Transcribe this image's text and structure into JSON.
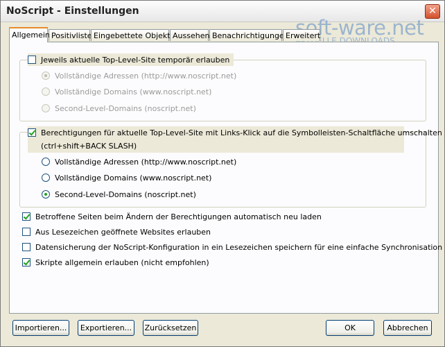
{
  "window": {
    "title": "NoScript - Einstellungen",
    "close_label": "✕"
  },
  "watermark": {
    "main": "soft-ware.net",
    "sub": "AKTUELLE DOWNLOADS"
  },
  "tabs": [
    {
      "label": "Allgemein",
      "active": true
    },
    {
      "label": "Positivliste",
      "active": false
    },
    {
      "label": "Eingebettete Objekte",
      "active": false
    },
    {
      "label": "Aussehen",
      "active": false
    },
    {
      "label": "Benachrichtigungen",
      "active": false
    },
    {
      "label": "Erweitert",
      "active": false
    }
  ],
  "group1": {
    "checkbox_label": "Jeweils aktuelle Top-Level-Site temporär erlauben",
    "checked": false,
    "options": [
      {
        "label": "Vollständige Adressen (http://www.noscript.net)",
        "selected": true
      },
      {
        "label": "Vollständige Domains (www.noscript.net)",
        "selected": false
      },
      {
        "label": "Second-Level-Domains (noscript.net)",
        "selected": false
      }
    ]
  },
  "group2": {
    "checkbox_label_line1": "Berechtigungen für aktuelle Top-Level-Site mit Links-Klick auf die Symbolleisten-Schaltfläche umschalten",
    "checkbox_label_line2": "(ctrl+shift+BACK SLASH)",
    "checked": true,
    "options": [
      {
        "label": "Vollständige Adressen (http://www.noscript.net)",
        "selected": false
      },
      {
        "label": "Vollständige Domains (www.noscript.net)",
        "selected": false
      },
      {
        "label": "Second-Level-Domains (noscript.net)",
        "selected": true
      }
    ]
  },
  "options": [
    {
      "label": "Betroffene Seiten beim Ändern der Berechtigungen automatisch neu laden",
      "checked": true
    },
    {
      "label": "Aus Lesezeichen geöffnete Websites erlauben",
      "checked": false
    },
    {
      "label": "Datensicherung der NoScript-Konfiguration in ein Lesezeichen speichern für eine einfache Synchronisation",
      "checked": false
    },
    {
      "label": "Skripte allgemein erlauben (nicht empfohlen)",
      "checked": true
    }
  ],
  "buttons": {
    "import": "Importieren...",
    "export": "Exportieren...",
    "reset": "Zurücksetzen",
    "ok": "OK",
    "cancel": "Abbrechen"
  }
}
